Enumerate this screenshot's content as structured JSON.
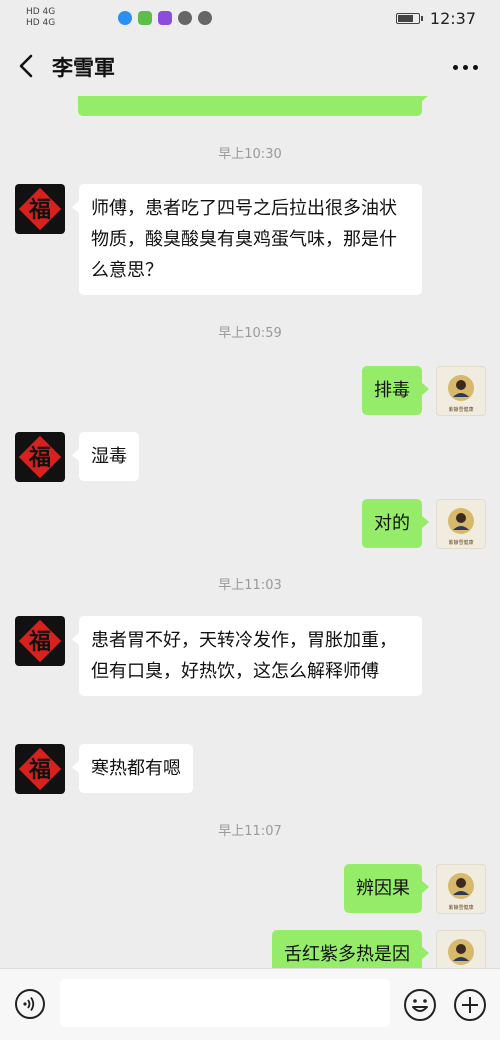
{
  "status_bar": {
    "sim1": "HD 4G",
    "sim2": "HD 4G",
    "time": "12:37"
  },
  "header": {
    "back_icon": "chevron-left-icon",
    "title": "李雪軍",
    "more_icon": "more-dots-icon"
  },
  "messages": [
    {
      "type": "bubble",
      "side": "out",
      "text": ""
    },
    {
      "type": "time",
      "text": "早上10:30"
    },
    {
      "type": "bubble",
      "side": "in",
      "text": "师傅，患者吃了四号之后拉出很多油状物质，酸臭酸臭有臭鸡蛋气味，那是什么意思？"
    },
    {
      "type": "time",
      "text": "早上10:59"
    },
    {
      "type": "bubble",
      "side": "out",
      "text": "排毒"
    },
    {
      "type": "bubble",
      "side": "in",
      "text": "湿毒"
    },
    {
      "type": "bubble",
      "side": "out",
      "text": "对的"
    },
    {
      "type": "time",
      "text": "早上11:03"
    },
    {
      "type": "bubble",
      "side": "in",
      "text": "患者胃不好，天转冷发作，胃胀加重，但有口臭，好热饮，这怎么解释师傅"
    },
    {
      "type": "bubble",
      "side": "in",
      "text": "寒热都有嗯"
    },
    {
      "type": "time",
      "text": "早上11:07"
    },
    {
      "type": "bubble",
      "side": "out",
      "text": "辨因果"
    },
    {
      "type": "bubble",
      "side": "out",
      "text": "舌红紫多热是因"
    }
  ],
  "avatars": {
    "contact": "福",
    "user_caption": "紫静雪健康"
  },
  "input_bar": {
    "voice_icon": "voice-icon",
    "placeholder": "",
    "emoji_icon": "emoji-icon",
    "plus_icon": "plus-icon"
  },
  "colors": {
    "background": "#ededed",
    "outgoing_bubble": "#95ec69",
    "incoming_bubble": "#ffffff",
    "timestamp": "#9a9a9a"
  }
}
